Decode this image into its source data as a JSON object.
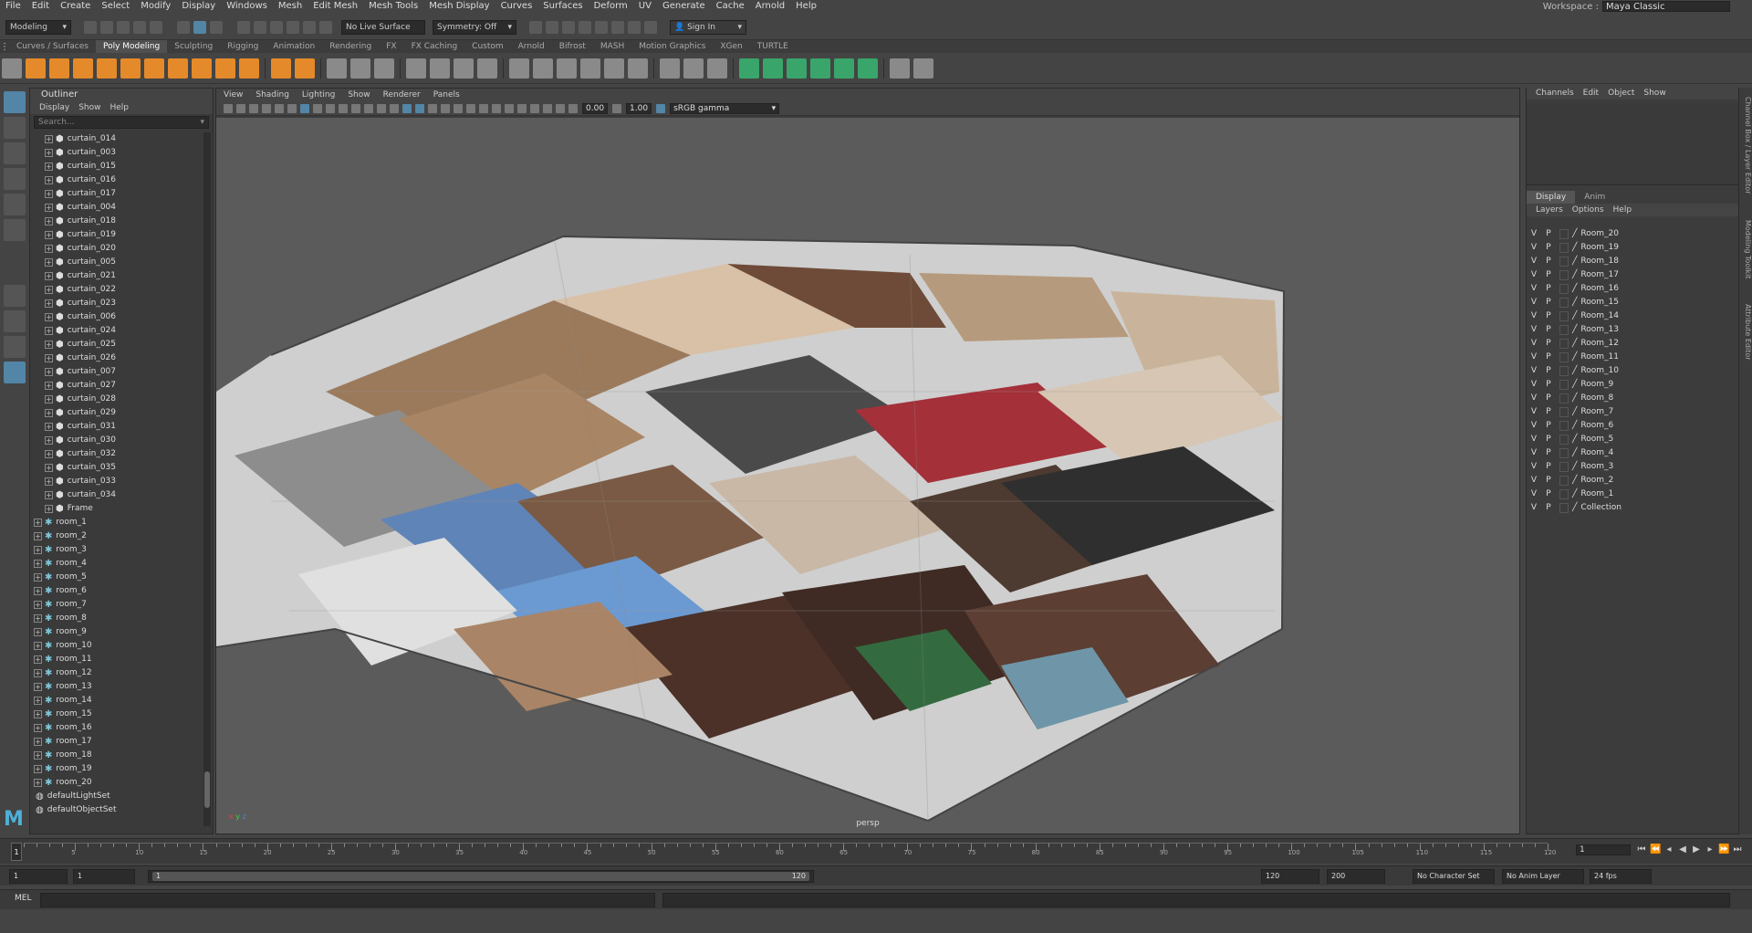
{
  "menus": [
    "File",
    "Edit",
    "Create",
    "Select",
    "Modify",
    "Display",
    "Windows",
    "Mesh",
    "Edit Mesh",
    "Mesh Tools",
    "Mesh Display",
    "Curves",
    "Surfaces",
    "Deform",
    "UV",
    "Generate",
    "Cache",
    "Arnold",
    "Help"
  ],
  "workspace": {
    "label": "Workspace :",
    "value": "Maya Classic"
  },
  "status": {
    "mode": "Modeling",
    "live_surface": "No Live Surface",
    "symmetry": "Symmetry: Off",
    "sign_in": "Sign In"
  },
  "shelf_tabs": [
    "Curves / Surfaces",
    "Poly Modeling",
    "Sculpting",
    "Rigging",
    "Animation",
    "Rendering",
    "FX",
    "FX Caching",
    "Custom",
    "Arnold",
    "Bifrost",
    "MASH",
    "Motion Graphics",
    "XGen",
    "TURTLE"
  ],
  "shelf_active": "Poly Modeling",
  "outliner": {
    "title": "Outliner",
    "menu": [
      "Display",
      "Show",
      "Help"
    ],
    "search_placeholder": "Search...",
    "items": [
      {
        "name": "curtain_014",
        "type": "mesh"
      },
      {
        "name": "curtain_003",
        "type": "mesh"
      },
      {
        "name": "curtain_015",
        "type": "mesh"
      },
      {
        "name": "curtain_016",
        "type": "mesh"
      },
      {
        "name": "curtain_017",
        "type": "mesh"
      },
      {
        "name": "curtain_004",
        "type": "mesh"
      },
      {
        "name": "curtain_018",
        "type": "mesh"
      },
      {
        "name": "curtain_019",
        "type": "mesh"
      },
      {
        "name": "curtain_020",
        "type": "mesh"
      },
      {
        "name": "curtain_005",
        "type": "mesh"
      },
      {
        "name": "curtain_021",
        "type": "mesh"
      },
      {
        "name": "curtain_022",
        "type": "mesh"
      },
      {
        "name": "curtain_023",
        "type": "mesh"
      },
      {
        "name": "curtain_006",
        "type": "mesh"
      },
      {
        "name": "curtain_024",
        "type": "mesh"
      },
      {
        "name": "curtain_025",
        "type": "mesh"
      },
      {
        "name": "curtain_026",
        "type": "mesh"
      },
      {
        "name": "curtain_007",
        "type": "mesh"
      },
      {
        "name": "curtain_027",
        "type": "mesh"
      },
      {
        "name": "curtain_028",
        "type": "mesh"
      },
      {
        "name": "curtain_029",
        "type": "mesh"
      },
      {
        "name": "curtain_031",
        "type": "mesh"
      },
      {
        "name": "curtain_030",
        "type": "mesh"
      },
      {
        "name": "curtain_032",
        "type": "mesh"
      },
      {
        "name": "curtain_035",
        "type": "mesh"
      },
      {
        "name": "curtain_033",
        "type": "mesh"
      },
      {
        "name": "curtain_034",
        "type": "mesh"
      },
      {
        "name": "Frame",
        "type": "mesh"
      },
      {
        "name": "room_1",
        "type": "group"
      },
      {
        "name": "room_2",
        "type": "group"
      },
      {
        "name": "room_3",
        "type": "group"
      },
      {
        "name": "room_4",
        "type": "group"
      },
      {
        "name": "room_5",
        "type": "group"
      },
      {
        "name": "room_6",
        "type": "group"
      },
      {
        "name": "room_7",
        "type": "group"
      },
      {
        "name": "room_8",
        "type": "group"
      },
      {
        "name": "room_9",
        "type": "group"
      },
      {
        "name": "room_10",
        "type": "group"
      },
      {
        "name": "room_11",
        "type": "group"
      },
      {
        "name": "room_12",
        "type": "group"
      },
      {
        "name": "room_13",
        "type": "group"
      },
      {
        "name": "room_14",
        "type": "group"
      },
      {
        "name": "room_15",
        "type": "group"
      },
      {
        "name": "room_16",
        "type": "group"
      },
      {
        "name": "room_17",
        "type": "group"
      },
      {
        "name": "room_18",
        "type": "group"
      },
      {
        "name": "room_19",
        "type": "group"
      },
      {
        "name": "room_20",
        "type": "group"
      },
      {
        "name": "defaultLightSet",
        "type": "set"
      },
      {
        "name": "defaultObjectSet",
        "type": "set"
      }
    ]
  },
  "viewport": {
    "menu": [
      "View",
      "Shading",
      "Lighting",
      "Show",
      "Renderer",
      "Panels"
    ],
    "exposure": "0.00",
    "gamma": "1.00",
    "color_space": "sRGB gamma",
    "camera": "persp"
  },
  "channel_box": {
    "menu": [
      "Channels",
      "Edit",
      "Object",
      "Show"
    ],
    "layer_tabs": [
      "Display",
      "Anim"
    ],
    "layer_menu": [
      "Layers",
      "Options",
      "Help"
    ],
    "layers": [
      "Room_20",
      "Room_19",
      "Room_18",
      "Room_17",
      "Room_16",
      "Room_15",
      "Room_14",
      "Room_13",
      "Room_12",
      "Room_11",
      "Room_10",
      "Room_9",
      "Room_8",
      "Room_7",
      "Room_6",
      "Room_5",
      "Room_4",
      "Room_3",
      "Room_2",
      "Room_1",
      "Collection"
    ],
    "v_label": "V",
    "p_label": "P",
    "side_tabs": [
      "Channel Box / Layer Editor",
      "Modeling Toolkit",
      "Attribute Editor"
    ]
  },
  "time": {
    "current_frame": "1",
    "ticks": [
      "5",
      "10",
      "15",
      "20",
      "25",
      "30",
      "35",
      "40",
      "45",
      "50",
      "55",
      "60",
      "65",
      "70",
      "75",
      "80",
      "85",
      "90",
      "95",
      "100",
      "105",
      "110",
      "115",
      "120"
    ],
    "frame_field": "1",
    "start": "1",
    "range_start_inner": "1",
    "range_start": "1",
    "range_end_inner": "120",
    "range_end": "120",
    "anim_end": "200",
    "character_set": "No Character Set",
    "anim_layer": "No Anim Layer",
    "fps": "24 fps"
  },
  "command_line": {
    "label": "MEL"
  },
  "accent": "#5285a6"
}
